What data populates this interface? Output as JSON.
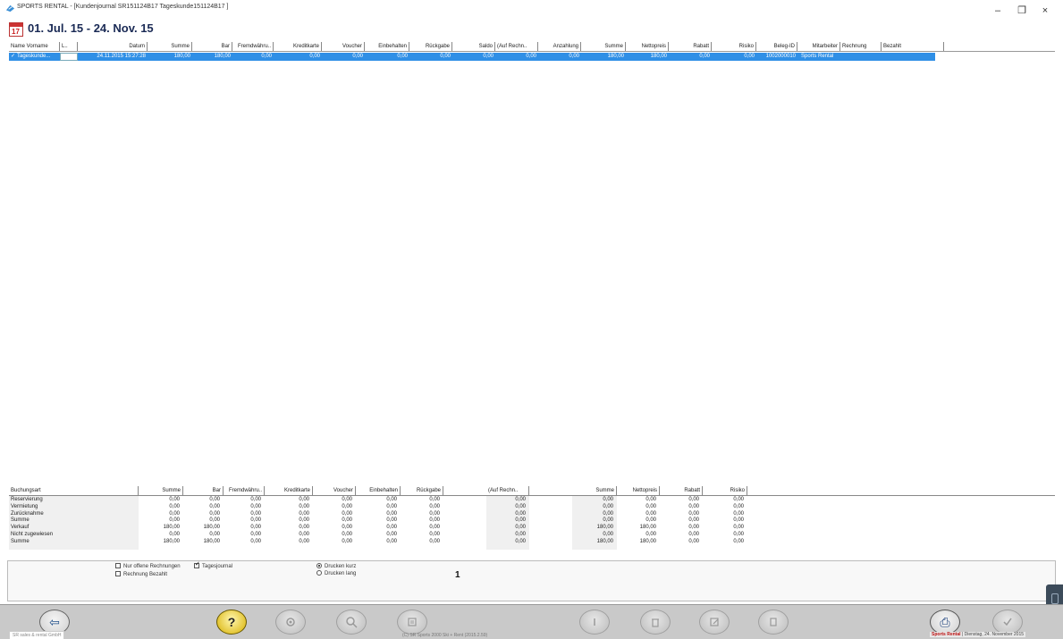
{
  "window": {
    "title": "SPORTS RENTAL - [Kundenjournal  SR151124B17 Tageskunde151124B17 ]",
    "controls": {
      "minimize": "–",
      "maximize": "❐",
      "close": "×"
    }
  },
  "header": {
    "calendar_day": "17",
    "date_range": "01. Jul. 15 - 24. Nov. 15"
  },
  "top_table": {
    "columns": [
      "Name Vorname",
      "L..",
      "Datum",
      "Summe",
      "Bar",
      "Fremdwähru..",
      "Kreditkarte",
      "Voucher",
      "Einbehalten",
      "Rückgabe",
      "Saldo",
      "(Auf Rechn..",
      "Anzahlung",
      "Summe",
      "Nettopreis",
      "Rabatt",
      "Risiko",
      "Beleg-ID",
      "Mitarbeiter",
      "Rechnung",
      "Bezahlt"
    ],
    "rows": [
      {
        "check": "✓",
        "name": "Tageskunde...",
        "lang": "",
        "datum": "24.11.2015 15:27:28",
        "summe": "180,00",
        "bar": "180,00",
        "fremd": "0,00",
        "kredit": "0,00",
        "voucher": "0,00",
        "einbehalten": "0,00",
        "rueckgabe": "0,00",
        "saldo": "0,00",
        "aufrechn": "0,00",
        "anzahlung": "0,00",
        "summe2": "180,00",
        "netto": "180,00",
        "rabatt": "0,00",
        "risiko": "0,00",
        "beleg": "1002000010",
        "mitarbeiter": "Sports Rental",
        "rechnung": "",
        "bezahlt": ""
      }
    ]
  },
  "bottom_table": {
    "columns": [
      "Buchungsart",
      "Summe",
      "Bar",
      "Fremdwähru..",
      "Kreditkarte",
      "Voucher",
      "Einbehalten",
      "Rückgabe",
      "(Auf Rechn..",
      "Summe",
      "Nettopreis",
      "Rabatt",
      "Risiko"
    ],
    "rows": [
      {
        "art": "Reservierung",
        "v": [
          "0,00",
          "0,00",
          "0,00",
          "0,00",
          "0,00",
          "0,00",
          "0,00",
          "0,00",
          "0,00",
          "0,00",
          "0,00",
          "0,00"
        ]
      },
      {
        "art": "Vermietung",
        "v": [
          "0,00",
          "0,00",
          "0,00",
          "0,00",
          "0,00",
          "0,00",
          "0,00",
          "0,00",
          "0,00",
          "0,00",
          "0,00",
          "0,00"
        ]
      },
      {
        "art": "Zurücknahme",
        "v": [
          "0,00",
          "0,00",
          "0,00",
          "0,00",
          "0,00",
          "0,00",
          "0,00",
          "0,00",
          "0,00",
          "0,00",
          "0,00",
          "0,00"
        ]
      },
      {
        "art": "Summe",
        "v": [
          "0,00",
          "0,00",
          "0,00",
          "0,00",
          "0,00",
          "0,00",
          "0,00",
          "0,00",
          "0,00",
          "0,00",
          "0,00",
          "0,00"
        ]
      },
      {
        "art": "Verkauf",
        "v": [
          "180,00",
          "180,00",
          "0,00",
          "0,00",
          "0,00",
          "0,00",
          "0,00",
          "0,00",
          "180,00",
          "180,00",
          "0,00",
          "0,00"
        ]
      },
      {
        "art": "Nicht zugewiesen",
        "v": [
          "0,00",
          "0,00",
          "0,00",
          "0,00",
          "0,00",
          "0,00",
          "0,00",
          "0,00",
          "0,00",
          "0,00",
          "0,00",
          "0,00"
        ]
      },
      {
        "art": "Summe",
        "v": [
          "180,00",
          "180,00",
          "0,00",
          "0,00",
          "0,00",
          "0,00",
          "0,00",
          "0,00",
          "180,00",
          "180,00",
          "0,00",
          "0,00"
        ]
      }
    ]
  },
  "options": {
    "nur_offene": {
      "label": "Nur offene Rechnungen",
      "checked": false
    },
    "tagesjournal": {
      "label": "Tagesjournal",
      "checked": true
    },
    "rechnung_bezahlt": {
      "label": "Rechnung Bezahlt",
      "checked": false
    },
    "drucken_kurz": {
      "label": "Drucken kurz",
      "checked": true
    },
    "drucken_lang": {
      "label": "Drucken lang",
      "checked": false
    },
    "page": "1"
  },
  "toolbar": {
    "back_glyph": "⇦",
    "help_glyph": "?",
    "print_glyph": "⎙"
  },
  "status": {
    "left": "SR sales & rental GmbH",
    "mid": "(C) SR Sports 2000  Ski + Rent (2015.2.59)",
    "right_red": "Sports Rental",
    "right": " | Dienstag, 24. November 2015"
  }
}
